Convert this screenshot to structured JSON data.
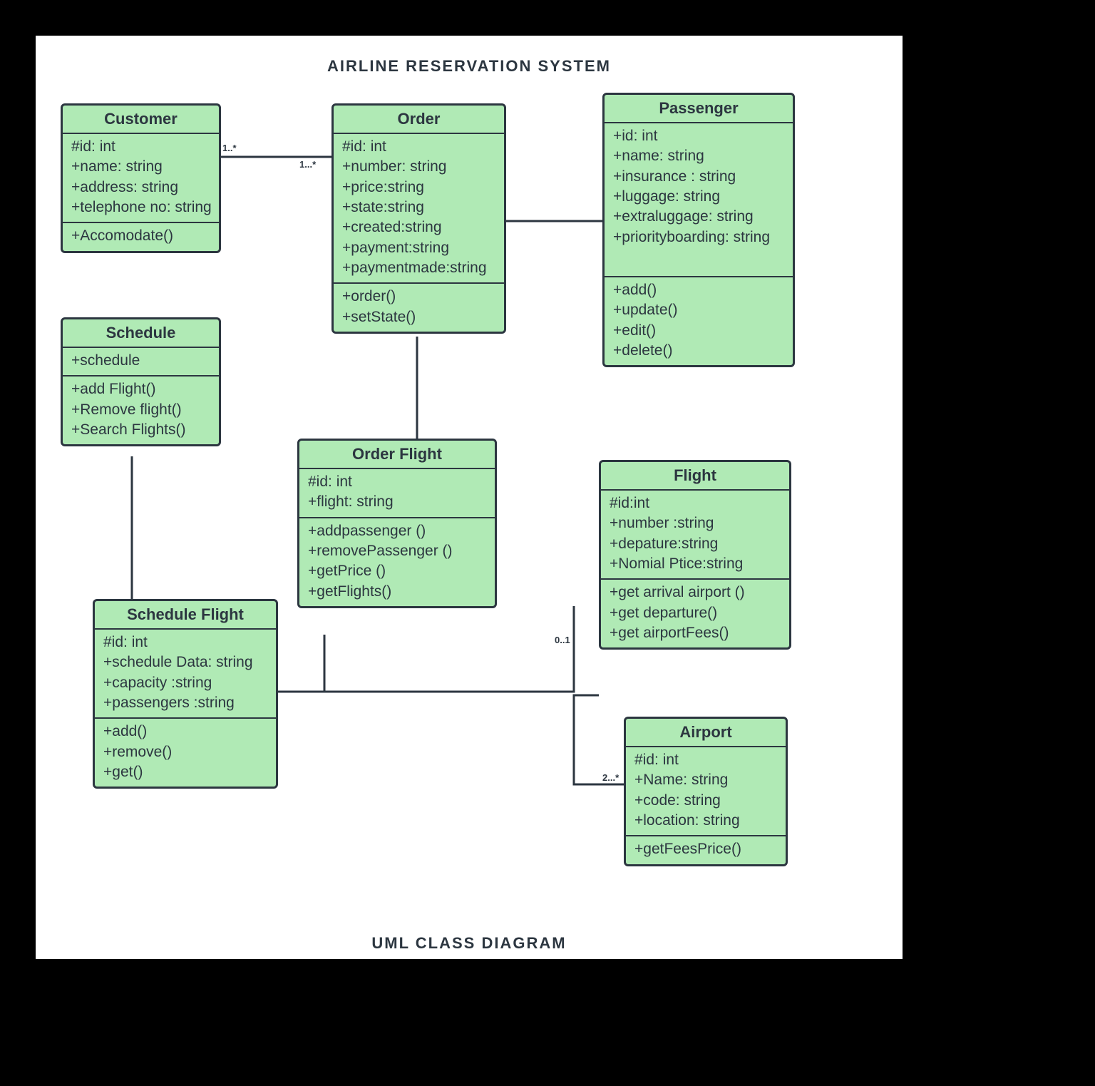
{
  "title": "AIRLINE RESERVATION SYSTEM",
  "subtitle": "UML CLASS DIAGRAM",
  "classes": {
    "customer": {
      "name": "Customer",
      "attrs": [
        "#id: int",
        "+name: string",
        "+address: string",
        "+telephone no: string"
      ],
      "ops": [
        "+Accomodate()"
      ]
    },
    "order": {
      "name": "Order",
      "attrs": [
        "#id: int",
        "+number: string",
        "+price:string",
        "+state:string",
        "+created:string",
        "+payment:string",
        "+paymentmade:string"
      ],
      "ops": [
        "+order()",
        "+setState()"
      ]
    },
    "passenger": {
      "name": "Passenger",
      "attrs": [
        "+id: int",
        "+name: string",
        "+insurance : string",
        "+luggage: string",
        "+extraluggage: string",
        "+priorityboarding: string"
      ],
      "ops": [
        "+add()",
        "+update()",
        "+edit()",
        "+delete()"
      ]
    },
    "schedule": {
      "name": "Schedule",
      "attrs": [
        "+schedule"
      ],
      "ops": [
        "+add Flight()",
        "+Remove flight()",
        "+Search Flights()"
      ]
    },
    "orderFlight": {
      "name": "Order Flight",
      "attrs": [
        "#id: int",
        "+flight: string"
      ],
      "ops": [
        "+addpassenger ()",
        "+removePassenger ()",
        "+getPrice ()",
        "+getFlights()"
      ]
    },
    "flight": {
      "name": "Flight",
      "attrs": [
        "#id:int",
        "+number :string",
        "+depature:string",
        "+Nomial Ptice:string"
      ],
      "ops": [
        "+get arrival airport ()",
        "+get departure()",
        "+get airportFees()"
      ]
    },
    "scheduleFlight": {
      "name": "Schedule Flight",
      "attrs": [
        "#id: int",
        "+schedule Data: string",
        "+capacity :string",
        "+passengers :string"
      ],
      "ops": [
        "+add()",
        "+remove()",
        "+get()"
      ]
    },
    "airport": {
      "name": "Airport",
      "attrs": [
        "#id: int",
        "+Name: string",
        "+code: string",
        "+location: string"
      ],
      "ops": [
        "+getFeesPrice()"
      ]
    }
  },
  "multiplicities": {
    "custOrderLeft": "1..*",
    "custOrderRight": "1...*",
    "flight01": "0..1",
    "airport2star": "2...*"
  }
}
